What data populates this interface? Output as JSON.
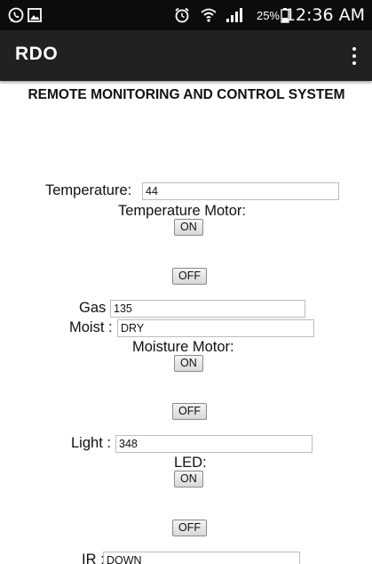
{
  "status_bar": {
    "icons": [
      "whatsapp-icon",
      "image-icon",
      "alarm-icon",
      "wifi-icon",
      "signal-icon",
      "battery-icon"
    ],
    "battery_percent": "25%",
    "time": "12:36 AM"
  },
  "app_bar": {
    "title": "RDO",
    "menu_icon": "overflow-menu-icon"
  },
  "page": {
    "title": "REMOTE MONITORING AND CONTROL SYSTEM"
  },
  "temperature": {
    "label": "Temperature:",
    "value": "44",
    "motor_label": "Temperature Motor:",
    "on_label": "ON",
    "off_label": "OFF"
  },
  "gas": {
    "label": "Gas :",
    "value": "135"
  },
  "moist": {
    "label": "Moist :",
    "value": "DRY",
    "motor_label": "Moisture Motor:",
    "on_label": "ON",
    "off_label": "OFF"
  },
  "light": {
    "label": "Light :",
    "value": "348",
    "led_label": "LED:",
    "on_label": "ON",
    "off_label": "OFF"
  },
  "ir": {
    "label": "IR :",
    "value": "DOWN"
  },
  "colors": {
    "status_bar": "#0c0c0c",
    "app_bar": "#212121",
    "background": "#ffffff"
  }
}
